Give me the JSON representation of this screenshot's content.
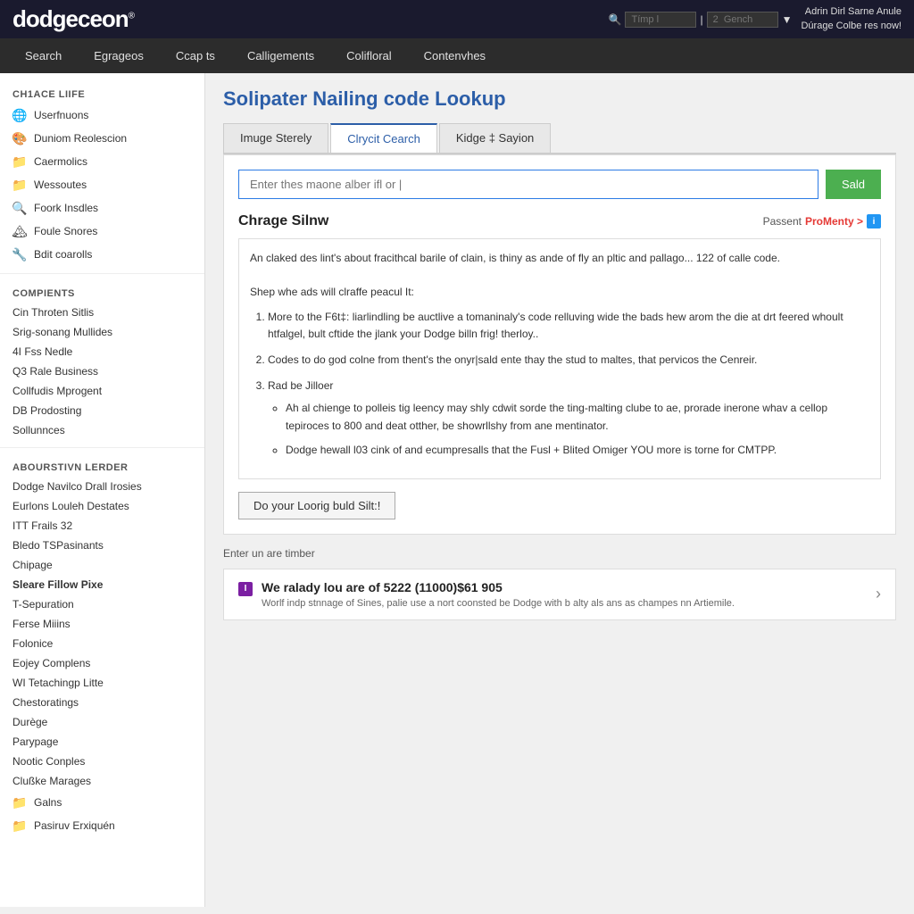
{
  "topbar": {
    "logo": "dodgeceon",
    "logo_sup": "®",
    "search1_placeholder": "Tímp l",
    "search2_placeholder": "2  Gench",
    "admin_line1": "Adrin Dirl Sarne Anule",
    "admin_line2": "Dúrage Colbe res now!"
  },
  "navbar": {
    "items": [
      {
        "label": "Search",
        "active": false
      },
      {
        "label": "Egrageos",
        "active": false
      },
      {
        "label": "Ccap ts",
        "active": false
      },
      {
        "label": "Calligements",
        "active": false
      },
      {
        "label": "Colifloral",
        "active": false
      },
      {
        "label": "Contenvhes",
        "active": false
      }
    ]
  },
  "sidebar": {
    "section1_title": "CH1ACE LIIFE",
    "items1": [
      {
        "label": "Userfnuons",
        "icon": "🌐",
        "icon_class": "green"
      },
      {
        "label": "Duniom Reolescion",
        "icon": "🎨",
        "icon_class": "rainbow"
      },
      {
        "label": "Caermolics",
        "icon": "📁",
        "icon_class": "orange"
      },
      {
        "label": "Wessoutes",
        "icon": "📁",
        "icon_class": "orange"
      },
      {
        "label": "Foork Insdles",
        "icon": "🔍",
        "icon_class": "gray"
      },
      {
        "label": "Foule Snores",
        "icon": "🏔",
        "icon_class": "mountain"
      },
      {
        "label": "Bdit coarolls",
        "icon": "🔧",
        "icon_class": "blue"
      }
    ],
    "section2_title": "COMPIENTS",
    "items2": [
      {
        "label": "Cin Throten Sitlis"
      },
      {
        "label": "Srig-sonang Mullides"
      },
      {
        "label": "4I Fss Nedle"
      },
      {
        "label": "Q3 Rale Business"
      },
      {
        "label": "Collfudis Mprogent"
      },
      {
        "label": "DB Prodosting"
      },
      {
        "label": "Sollunnces"
      }
    ],
    "section3_title": "ABOURSTIVN LERDER",
    "items3": [
      {
        "label": "Dodge Navilco Drall Irosies"
      },
      {
        "label": "Eurlons Louleh Destates"
      },
      {
        "label": "ITT Frails 32"
      },
      {
        "label": "Bledo TSPasinants"
      },
      {
        "label": "Chipage"
      },
      {
        "label": "Sleare Fillow Pixe",
        "bold": true
      },
      {
        "label": "T-Sepuration"
      },
      {
        "label": "Ferse Miiins"
      },
      {
        "label": "Folonice"
      },
      {
        "label": "Eojey Complens"
      },
      {
        "label": "WI Tetachingp Litte"
      },
      {
        "label": "Chestoratings"
      },
      {
        "label": "Durège"
      },
      {
        "label": "Parypage"
      },
      {
        "label": "Nootic Conples"
      },
      {
        "label": "Clußke Marages"
      },
      {
        "label": "Galns",
        "icon": "📁",
        "icon_class": "orange"
      },
      {
        "label": "Pasiruv Erxiquén",
        "icon": "📁",
        "icon_class": "orange"
      }
    ]
  },
  "main": {
    "page_title": "Solipater Nailing code Lookup",
    "tabs": [
      {
        "label": "Imuge Sterely",
        "active": false
      },
      {
        "label": "Clrycit Cearch",
        "active": true
      },
      {
        "label": "Kidge ‡ Sayion",
        "active": false
      }
    ],
    "search_placeholder": "Enter thes maone alber ifl or |",
    "search_button": "Sald",
    "content_heading": "Chrage Silnw",
    "passent_label": "Passent",
    "pro_label": "ProMenty >",
    "description_para": "An claked des lint's about fracithcal barile of clain, is thiny as ande of fly an pltic and pallago... 122 of calle code.",
    "step_intro": "Shep whe ads will clraffe peacul It:",
    "steps": [
      {
        "text": "More to the F6t‡: liarlindling be auctlive a tomaninaly's code relluving wide the bads hew arom the die at drt feered whoult htfalgel, bult cftide the jlank your Dodge billn frig! therloy.."
      },
      {
        "text": "Codes to do god colne from thent's the onyr|sald ente thay the stud to maltes, that pervicos the Cenreir."
      },
      {
        "text": "Rad be Jilloer",
        "subitems": [
          "Ah al chienge to polleis tig leency may shly cdwit sorde the ting-malting clube to ae, prorade inerone whav a cellop tepiroces to 800 and deat otther, be showrllshy from ane mentinator.",
          "Dodge hewall l03 cink of and ecumpresalls that the Fusl + Blited Omiger YOU more is torne for CMTPP."
        ]
      }
    ],
    "footer_button": "Do your Loorig buld Silt:!",
    "info_label": "Enter un are timber",
    "alert_title": "We ralady lou are of 5222 (11000)$61 905",
    "alert_desc": "Worlf indp stnnage of Sines, palie use a nort coonsted be Dodge with b alty als ans as champes nn Artiemile.",
    "chevron": "›"
  }
}
